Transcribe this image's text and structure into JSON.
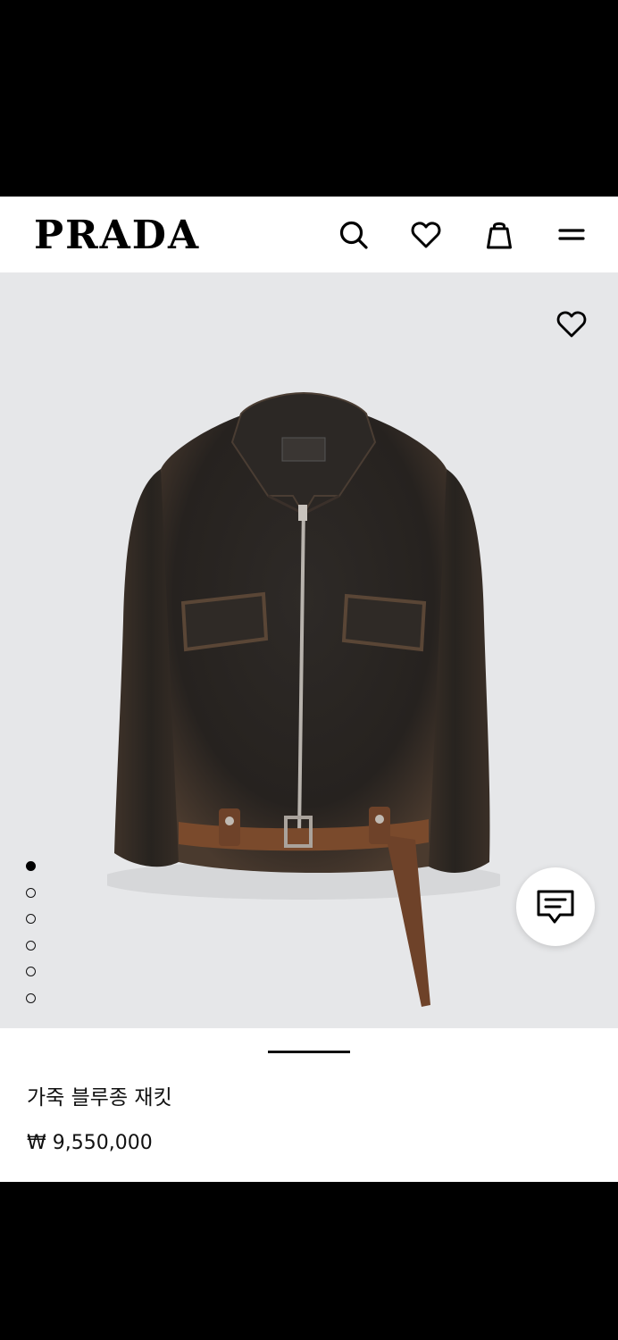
{
  "brand": {
    "logo_text": "PRADA"
  },
  "header": {
    "icons": [
      "search-icon",
      "heart-icon",
      "shopping-bag-icon",
      "menu-icon"
    ]
  },
  "hero": {
    "image_subject": "leather-jacket",
    "wishlist_icon": "heart-icon",
    "carousel": {
      "total": 6,
      "active_index": 0
    },
    "chat_icon": "chat-icon"
  },
  "product": {
    "title": "가죽 블루종 재킷",
    "price": "₩ 9,550,000"
  },
  "colors": {
    "background": "#e6e7e9",
    "header_bg": "#ffffff",
    "text": "#111111",
    "jacket": "#2a2623",
    "belt": "#7a4a2c"
  }
}
